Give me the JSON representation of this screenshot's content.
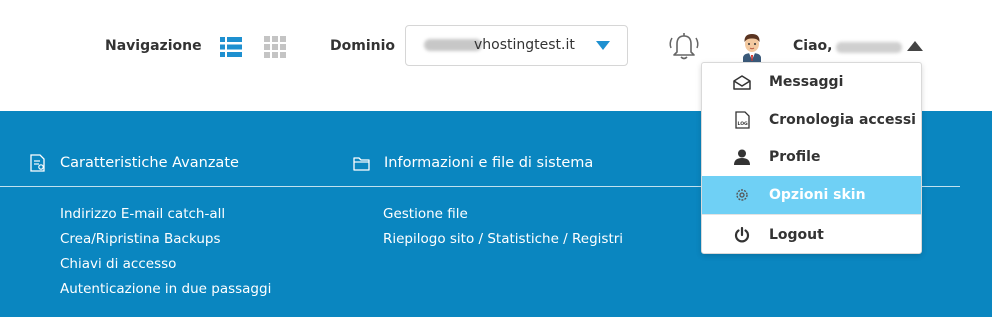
{
  "header": {
    "navigation_label": "Navigazione",
    "domain_label": "Dominio",
    "domain_value": "vhostingtest.it",
    "greeting": "Ciao,"
  },
  "icons": {
    "list_view": "list-view-icon",
    "grid_view": "grid-view-icon",
    "bell": "notification-bell-icon",
    "avatar": "user-avatar-icon"
  },
  "colors": {
    "accent": "#1e90d0",
    "panel_bg": "#0a86c0",
    "active_item_bg": "#6fd0f5"
  },
  "main": {
    "sections": [
      {
        "title": "Caratteristiche Avanzate",
        "links": [
          "Indirizzo E-mail catch-all",
          "Crea/Ripristina Backups",
          "Chiavi di accesso",
          "Autenticazione in due passaggi"
        ]
      },
      {
        "title": "Informazioni e file di sistema",
        "links": [
          "Gestione file",
          "Riepilogo sito / Statistiche / Registri"
        ]
      }
    ]
  },
  "user_menu": {
    "items": [
      {
        "label": "Messaggi",
        "icon": "envelope-icon"
      },
      {
        "label": "Cronologia accessi",
        "icon": "log-file-icon"
      },
      {
        "label": "Profile",
        "icon": "user-icon"
      },
      {
        "label": "Opzioni skin",
        "icon": "gear-icon",
        "active": true
      },
      {
        "label": "Logout",
        "icon": "power-icon"
      }
    ]
  }
}
